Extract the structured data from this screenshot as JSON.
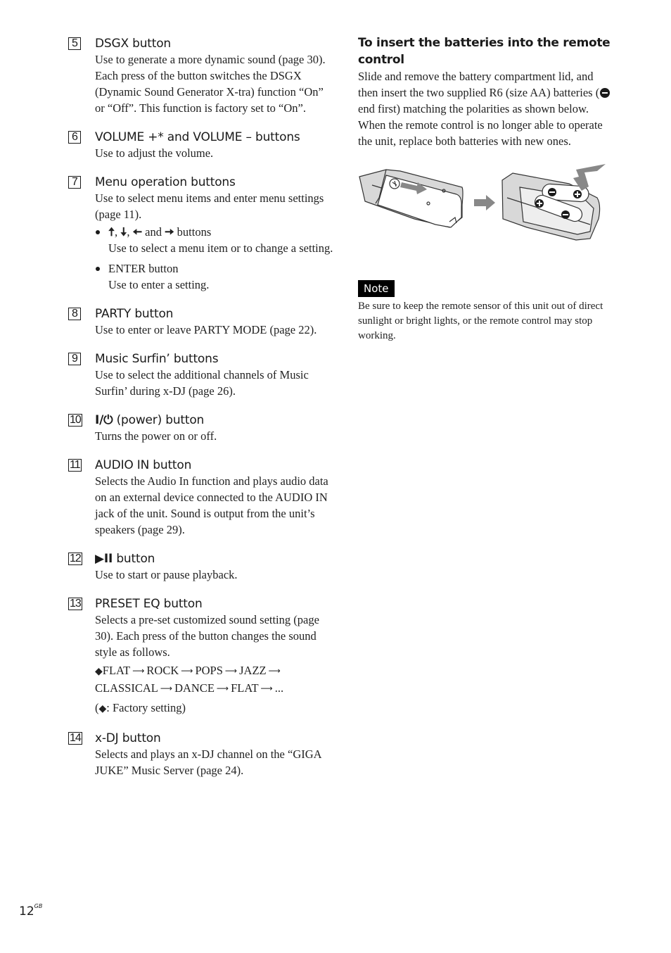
{
  "left_column": {
    "items": [
      {
        "number": "5",
        "title": "DSGX button",
        "body": "Use to generate a more dynamic sound (page 30). Each press of the button switches the DSGX (Dynamic Sound Generator X-tra) function “On” or “Off”. This function is factory set to “On”."
      },
      {
        "number": "6",
        "title": "VOLUME +* and VOLUME – buttons",
        "body": "Use to adjust the volume."
      },
      {
        "number": "7",
        "title": "Menu operation buttons",
        "body": "Use to select menu items and enter menu settings (page 11).",
        "bullets": [
          {
            "glyphs": {
              "up": "🠅",
              "down": "🠇",
              "left": "🠄",
              "right": "🠆"
            },
            "sep1": ",",
            "sep2": ",",
            "and": "and",
            "label_suffix": "buttons",
            "desc": "Use to select a menu item or to change a setting."
          },
          {
            "label": "ENTER button",
            "desc": "Use to enter a setting."
          }
        ]
      },
      {
        "number": "8",
        "title": "PARTY button",
        "body": "Use to enter or leave PARTY MODE (page 22)."
      },
      {
        "number": "9",
        "title": "Music Surfin’ buttons",
        "body": "Use to select the additional channels of Music Surfin’ during x-DJ (page 26)."
      },
      {
        "number": "10",
        "title_glyph": "I/⏻",
        "title": "(power) button",
        "body": "Turns the power on or off."
      },
      {
        "number": "11",
        "title": "AUDIO IN button",
        "body": "Selects the Audio In function and plays audio data on an external device connected to the AUDIO IN jack of the unit. Sound is output from the unit’s speakers (page 29)."
      },
      {
        "number": "12",
        "title_glyph": "▶II",
        "title": "button",
        "body": "Use to start or pause playback."
      },
      {
        "number": "13",
        "title": "PRESET EQ button",
        "body": "Selects a pre-set customized sound setting (page 30). Each press of the button changes the sound style as follows.",
        "eq_sequence": [
          "FLAT",
          "ROCK",
          "POPS",
          "JAZZ",
          "CLASSICAL",
          "DANCE",
          "FLAT",
          "..."
        ],
        "factory_marker": "◆",
        "arrow": "⟶",
        "factory_note": ": Factory setting"
      },
      {
        "number": "14",
        "title": "x-DJ button",
        "body": "Selects and plays an x-DJ channel on the “GIGA JUKE” Music Server (page 24)."
      }
    ]
  },
  "right_column": {
    "heading": "To insert the batteries into the remote control",
    "para1_a": "Slide and remove the battery compartment lid, and then insert the two supplied R6 (size AA) batteries (",
    "para1_b": " end first) matching the polarities as shown below.",
    "para2": "When the remote control is no longer able to operate the unit, replace both batteries with new ones.",
    "illustration_alt": "Battery compartment lid sliding off, then two AA batteries inserted matching polarity",
    "note": {
      "label": "Note",
      "text": "Be sure to keep the remote sensor of this unit out of direct sunlight or bright lights, or the remote control may stop working."
    }
  },
  "footer": {
    "page_number": "12",
    "page_suffix": "GB"
  }
}
